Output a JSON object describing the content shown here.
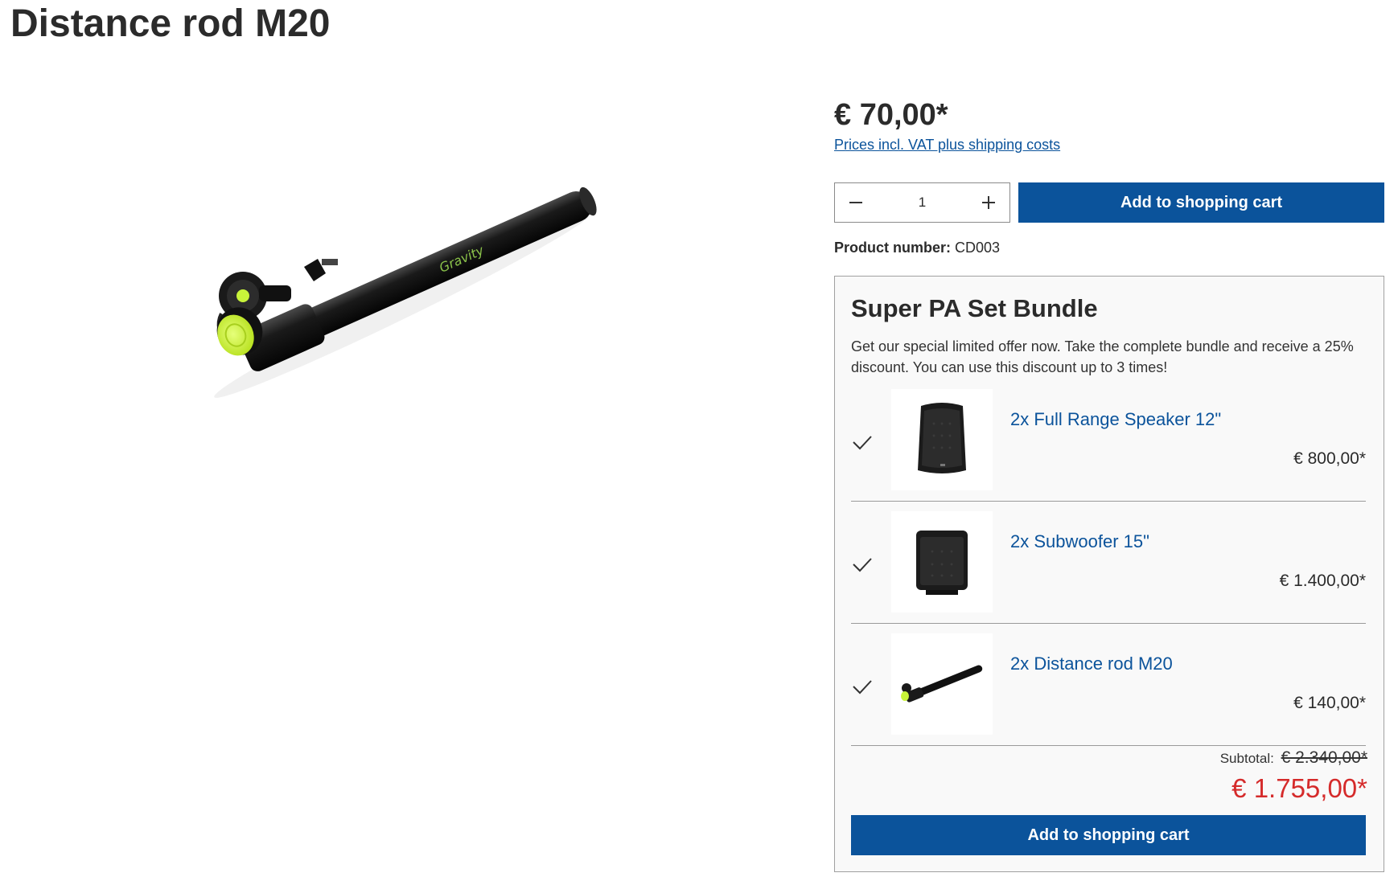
{
  "product": {
    "title": "Distance rod M20",
    "price": "€ 70,00*",
    "tax_note": "Prices incl. VAT plus shipping costs",
    "quantity": "1",
    "add_to_cart": "Add to shopping cart",
    "product_number_label": "Product number:",
    "product_number": "CD003",
    "image_brand_text": "Gravity"
  },
  "bundle": {
    "title": "Super PA Set Bundle",
    "description": "Get our special limited offer now. Take the complete bundle and receive a 25% discount. You can use this discount up to 3 times!",
    "items": [
      {
        "name": "2x Full Range Speaker 12\"",
        "price": "€ 800,00*",
        "icon": "speaker-image"
      },
      {
        "name": "2x Subwoofer 15\"",
        "price": "€ 1.400,00*",
        "icon": "subwoofer-image"
      },
      {
        "name": "2x Distance rod M20",
        "price": "€ 140,00*",
        "icon": "distance-rod-image"
      }
    ],
    "subtotal_label": "Subtotal:",
    "subtotal_old": "€ 2.340,00*",
    "total": "€ 1.755,00*",
    "add_to_cart": "Add to shopping cart"
  },
  "colors": {
    "primary": "#0b539b",
    "sale": "#d52b2b",
    "accent_green": "#c8f33a"
  }
}
